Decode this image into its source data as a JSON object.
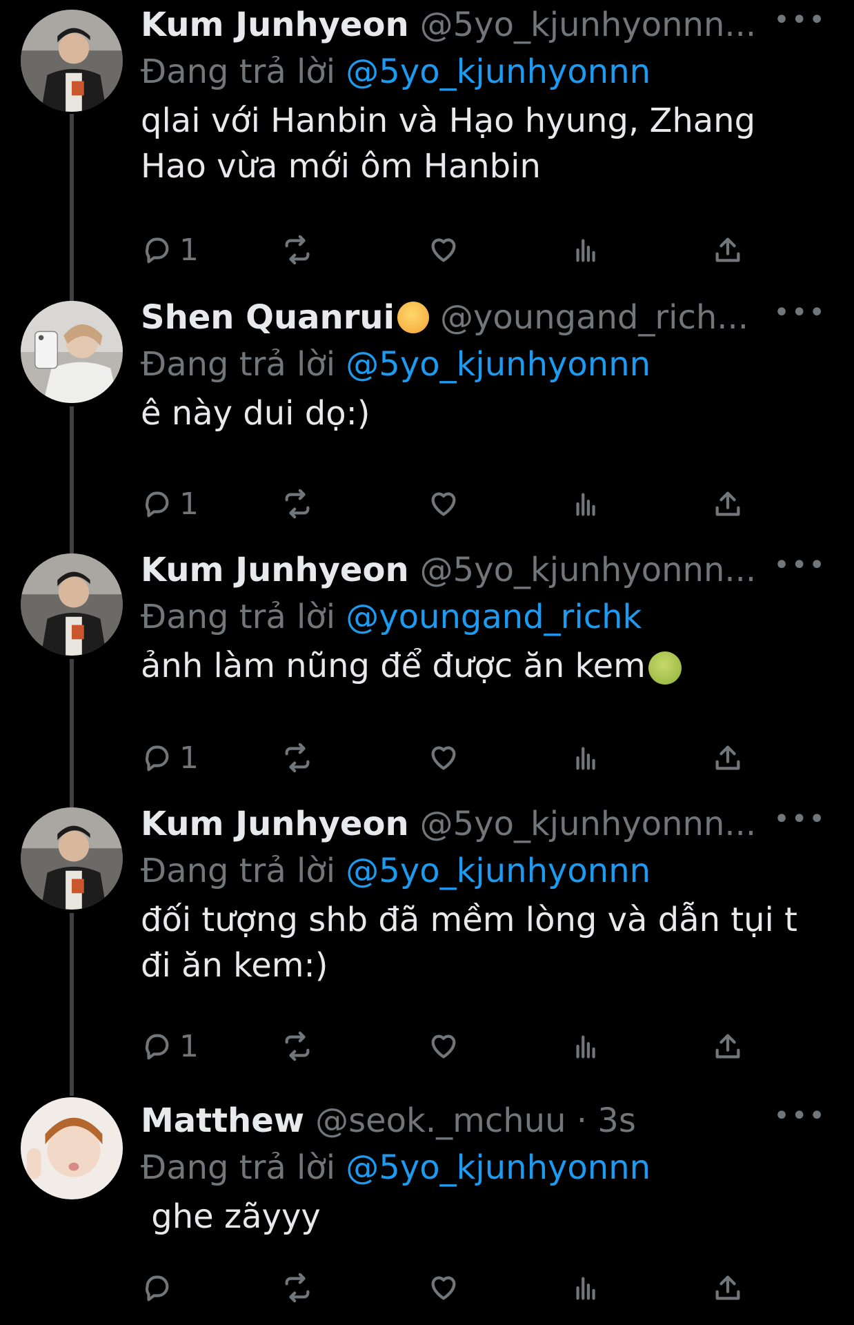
{
  "tweets": [
    {
      "name": "Kum Junhyeon",
      "handle": "@5yo_kjunhyonnn...",
      "more": "•••",
      "replying_prefix": "Đang trả lời ",
      "replying_to": "@5yo_kjunhyonnn",
      "text": "qlai với Hanbin và Hạo hyung, Zhang Hao vừa mới ôm Hanbin",
      "reply_count": "1",
      "avatar_icon": "avatar-kum-junhyeon"
    },
    {
      "name": "Shen Quanrui",
      "name_emoji": "dizzy-face-emoji",
      "handle": "@youngand_rich...",
      "more": "•••",
      "replying_prefix": "Đang trả lời ",
      "replying_to": "@5yo_kjunhyonnn",
      "text": "ê này dui dọ:)",
      "reply_count": "1",
      "avatar_icon": "avatar-shen-quanrui"
    },
    {
      "name": "Kum Junhyeon",
      "handle": "@5yo_kjunhyonnn...",
      "more": "•••",
      "replying_prefix": "Đang trả lời ",
      "replying_to": "@youngand_richk",
      "text": "ảnh làm nũng để được ăn kem",
      "text_emoji": "nauseated-face-emoji",
      "reply_count": "1",
      "avatar_icon": "avatar-kum-junhyeon"
    },
    {
      "name": "Kum Junhyeon",
      "handle": "@5yo_kjunhyonnn...",
      "more": "•••",
      "replying_prefix": "Đang trả lời ",
      "replying_to": "@5yo_kjunhyonnn",
      "text": "đối tượng shb đã mềm lòng và dẫn tụi t đi ăn kem:)",
      "reply_count": "1",
      "avatar_icon": "avatar-kum-junhyeon"
    },
    {
      "name": "Matthew",
      "handle": "@seok._mchuu · 3s",
      "more": "•••",
      "replying_prefix": "Đang trả lời ",
      "replying_to": "@5yo_kjunhyonnn",
      "text": " ghe zãyyy",
      "reply_count": "",
      "avatar_icon": "avatar-matthew"
    }
  ],
  "colors": {
    "background": "#000000",
    "text": "#e7e9ea",
    "muted": "#71767b",
    "link": "#1d9bf0",
    "thread_line": "#3e4144"
  }
}
